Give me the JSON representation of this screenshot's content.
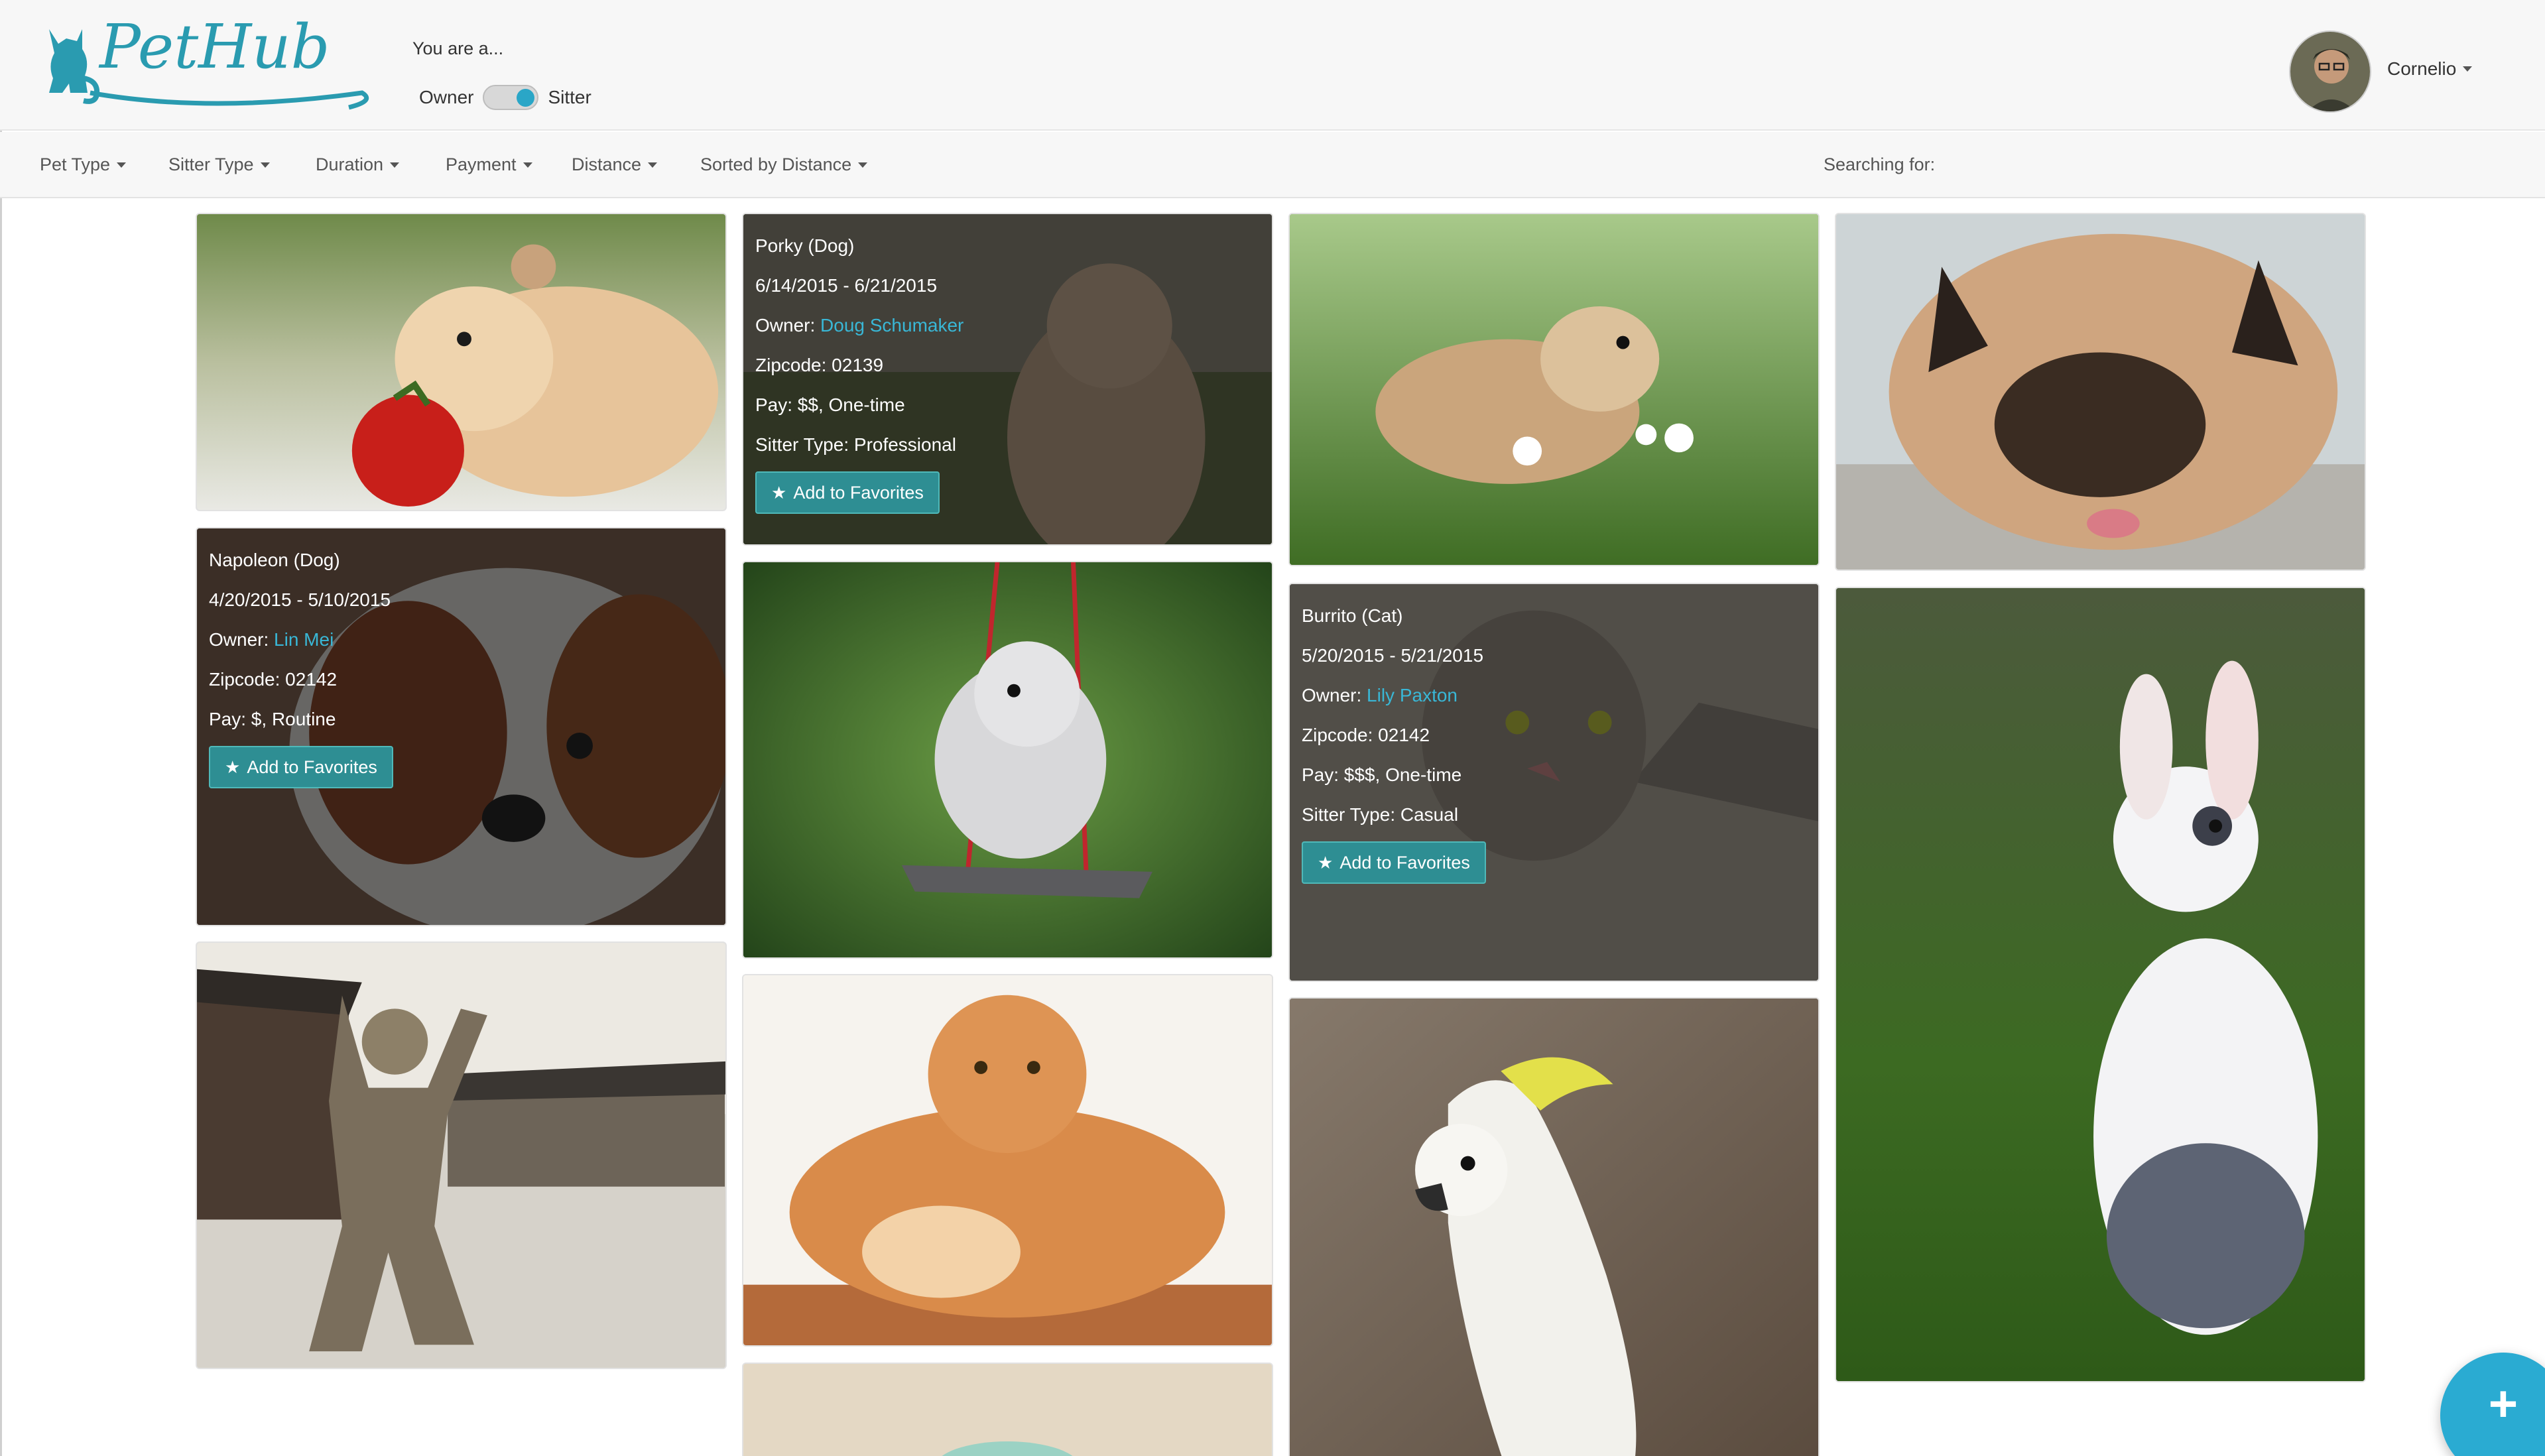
{
  "brand": {
    "logo_text": "PetHub",
    "accent": "#2a9bb0"
  },
  "role": {
    "title": "You are a...",
    "owner_label": "Owner",
    "sitter_label": "Sitter",
    "toggle_state": "sitter"
  },
  "user": {
    "name": "Cornelio"
  },
  "filters": [
    {
      "label": "Pet Type"
    },
    {
      "label": "Sitter Type"
    },
    {
      "label": "Duration"
    },
    {
      "label": "Payment"
    },
    {
      "label": "Distance"
    },
    {
      "label": "Sorted by Distance"
    }
  ],
  "search": {
    "label": "Searching for:"
  },
  "cards": {
    "porky": {
      "name": "Porky (Dog)",
      "dates": "6/14/2015 - 6/21/2015",
      "owner_prefix": "Owner: ",
      "owner": "Doug Schumaker",
      "zipcode": "Zipcode: 02139",
      "pay": "Pay: $$, One-time",
      "sitter_type": "Sitter Type: Professional",
      "fav_label": "Add to Favorites"
    },
    "napoleon": {
      "name": "Napoleon (Dog)",
      "dates": "4/20/2015 - 5/10/2015",
      "owner_prefix": "Owner: ",
      "owner": "Lin Mei",
      "zipcode": "Zipcode: 02142",
      "pay": "Pay: $, Routine",
      "fav_label": "Add to Favorites"
    },
    "burrito": {
      "name": "Burrito (Cat)",
      "dates": "5/20/2015 - 5/21/2015",
      "owner_prefix": "Owner: ",
      "owner": "Lily Paxton",
      "zipcode": "Zipcode: 02142",
      "pay": "Pay: $$$, One-time",
      "sitter_type": "Sitter Type: Casual",
      "fav_label": "Add to Favorites"
    }
  },
  "fab": {
    "icon": "plus-icon"
  }
}
